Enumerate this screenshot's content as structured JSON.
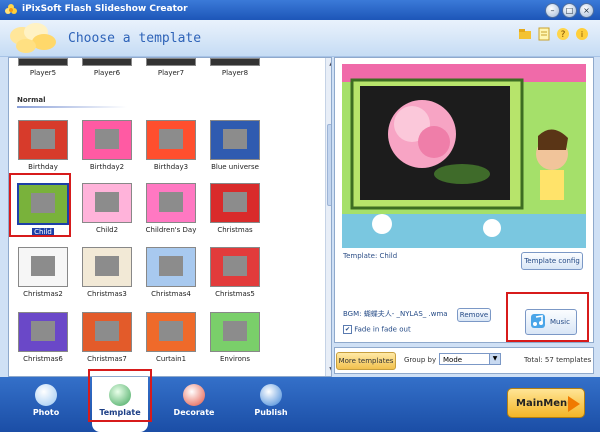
{
  "window": {
    "title": "iPixSoft Flash Slideshow Creator"
  },
  "header": {
    "title": "Choose a template"
  },
  "templates": {
    "top_row": [
      "Player5",
      "Player6",
      "Player7",
      "Player8"
    ],
    "section_title": "Normal",
    "items": [
      {
        "label": "Birthday",
        "color": "#d73b2b"
      },
      {
        "label": "Birthday2",
        "color": "#ff5aa3"
      },
      {
        "label": "Birthday3",
        "color": "#ff4f2e"
      },
      {
        "label": "Blue universe",
        "color": "#2f5bb0"
      },
      {
        "label": "Child",
        "color": "#79b23b",
        "selected": true
      },
      {
        "label": "Child2",
        "color": "#ffb3da"
      },
      {
        "label": "Children's Day",
        "color": "#ff78c2"
      },
      {
        "label": "Christmas",
        "color": "#d92b2b"
      },
      {
        "label": "Christmas2",
        "color": "#f6f6f6"
      },
      {
        "label": "Christmas3",
        "color": "#f2e9d6"
      },
      {
        "label": "Christmas4",
        "color": "#a8c9ef"
      },
      {
        "label": "Christmas5",
        "color": "#e23b3b"
      },
      {
        "label": "Christmas6",
        "color": "#6a48c8"
      },
      {
        "label": "Christmas7",
        "color": "#e35b2a"
      },
      {
        "label": "Curtain1",
        "color": "#ef6a2a"
      },
      {
        "label": "Environs",
        "color": "#7acf6a"
      }
    ]
  },
  "right_panel": {
    "template_label": "Template: Child",
    "template_config_label": "Template config",
    "bgm_text": "BGM: 蝴蝶夫人- _NYLAS_ .wma",
    "remove_label": "Remove",
    "fade_label": "Fade in fade out",
    "fade_checked": "✔",
    "music_label": "Music"
  },
  "bottom": {
    "more_templates_label": "More templates",
    "group_by_label": "Group by",
    "group_by_value": "Mode",
    "total_text": "Total: 57 templates"
  },
  "nav": {
    "tabs": [
      {
        "label": "Photo"
      },
      {
        "label": "Template",
        "active": true
      },
      {
        "label": "Decorate"
      },
      {
        "label": "Publish"
      }
    ],
    "mainmenu_label": "MainMenu"
  },
  "icons": {
    "app": "flower-icon",
    "header_icons": [
      "folder-icon",
      "note-icon",
      "help-icon",
      "info-icon"
    ]
  }
}
